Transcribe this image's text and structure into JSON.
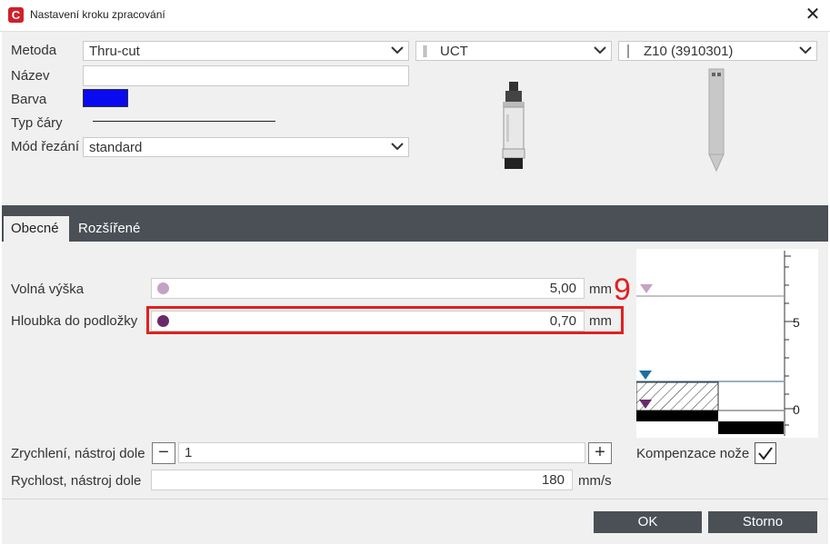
{
  "window": {
    "title": "Nastavení kroku zpracování",
    "app_logo": "C"
  },
  "top": {
    "method_label": "Metoda",
    "method_value": "Thru-cut",
    "tool_value": "UCT",
    "knife_value": "Z10 (3910301)",
    "name_label": "Název",
    "name_value": "",
    "color_label": "Barva",
    "color_value": "#0a0af0",
    "linetype_label": "Typ čáry",
    "cutmode_label": "Mód řezání",
    "cutmode_value": "standard"
  },
  "tabs": [
    {
      "label": "Obecné",
      "active": true
    },
    {
      "label": "Rozšířené",
      "active": false
    }
  ],
  "general": {
    "free_height_label": "Volná výška",
    "free_height_value": "5,00",
    "free_height_unit": "mm",
    "free_height_dot_color": "#c4a2c4",
    "depth_label": "Hloubka do podložky",
    "depth_value": "0,70",
    "depth_unit": "mm",
    "depth_dot_color": "#6a2a6a",
    "accel_label": "Zrychlení, nástroj dole",
    "accel_value": "1",
    "speed_label": "Rychlost, nástroj dole",
    "speed_value": "180",
    "speed_unit": "mm/s",
    "knife_comp_label": "Kompenzace nože",
    "knife_comp_checked": true
  },
  "annotation": {
    "number": "9",
    "color": "#e02020"
  },
  "scale": {
    "tick_5": "5",
    "tick_0": "0"
  },
  "buttons": {
    "ok": "OK",
    "cancel": "Storno"
  }
}
